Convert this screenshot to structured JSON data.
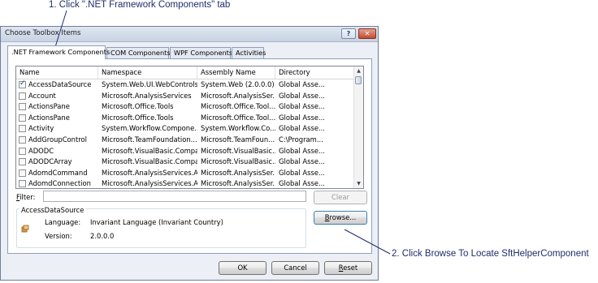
{
  "annotations": {
    "step1": "1. Click \".NET Framework Components\" tab",
    "step2": "2. Click Browse To Locate SftHelperComponent"
  },
  "window": {
    "title": "Choose Toolbox Items",
    "help_glyph": "?",
    "close_glyph": "✕"
  },
  "tabs": [
    {
      "label": ".NET Framework Components",
      "active": true
    },
    {
      "label": "COM Components"
    },
    {
      "label": "WPF Components"
    },
    {
      "label": "Activities"
    }
  ],
  "columns": [
    "Name",
    "Namespace",
    "Assembly Name",
    "Directory"
  ],
  "rows": [
    {
      "checked": true,
      "name": "AccessDataSource",
      "namespace": "System.Web.UI.WebControls",
      "assembly": "System.Web (2.0.0.0)",
      "directory": "Global Asse..."
    },
    {
      "checked": false,
      "name": "Account",
      "namespace": "Microsoft.AnalysisServices",
      "assembly": "Microsoft.AnalysisSer...",
      "directory": "Global Asse..."
    },
    {
      "checked": false,
      "name": "ActionsPane",
      "namespace": "Microsoft.Office.Tools",
      "assembly": "Microsoft.Office.Tool...",
      "directory": "Global Asse..."
    },
    {
      "checked": false,
      "name": "ActionsPane",
      "namespace": "Microsoft.Office.Tools",
      "assembly": "Microsoft.Office.Tool...",
      "directory": "Global Asse..."
    },
    {
      "checked": false,
      "name": "Activity",
      "namespace": "System.Workflow.Compone...",
      "assembly": "System.Workflow.Co...",
      "directory": "Global Asse..."
    },
    {
      "checked": false,
      "name": "AddGroupControl",
      "namespace": "Microsoft.TeamFoundation...",
      "assembly": "Microsoft.TeamFoun...",
      "directory": "C:\\Program..."
    },
    {
      "checked": false,
      "name": "ADODC",
      "namespace": "Microsoft.VisualBasic.Compa...",
      "assembly": "Microsoft.VisualBasic...",
      "directory": "Global Asse..."
    },
    {
      "checked": false,
      "name": "ADODCArray",
      "namespace": "Microsoft.VisualBasic.Compa...",
      "assembly": "Microsoft.VisualBasic...",
      "directory": "Global Asse..."
    },
    {
      "checked": false,
      "name": "AdomdCommand",
      "namespace": "Microsoft.AnalysisServices.A...",
      "assembly": "Microsoft.AnalysisSer...",
      "directory": "Global Asse..."
    },
    {
      "checked": false,
      "name": "AdomdConnection",
      "namespace": "Microsoft.AnalysisServices.A...",
      "assembly": "Microsoft.AnalysisSer...",
      "directory": "Global Asse..."
    }
  ],
  "filter": {
    "label_prefix": "F",
    "label_rest": "ilter:",
    "value": ""
  },
  "buttons": {
    "clear": "Clear",
    "browse_prefix": "B",
    "browse_rest": "rowse...",
    "ok": "OK",
    "cancel": "Cancel",
    "reset_prefix": "R",
    "reset_rest": "eset"
  },
  "details": {
    "group_title": "AccessDataSource",
    "language_label": "Language:",
    "language_value": "Invariant Language (Invariant Country)",
    "version_label": "Version:",
    "version_value": "2.0.0.0"
  },
  "icons": {
    "component": "component-icon",
    "scroll_up": "scroll-up-icon",
    "scroll_down": "scroll-down-icon"
  }
}
